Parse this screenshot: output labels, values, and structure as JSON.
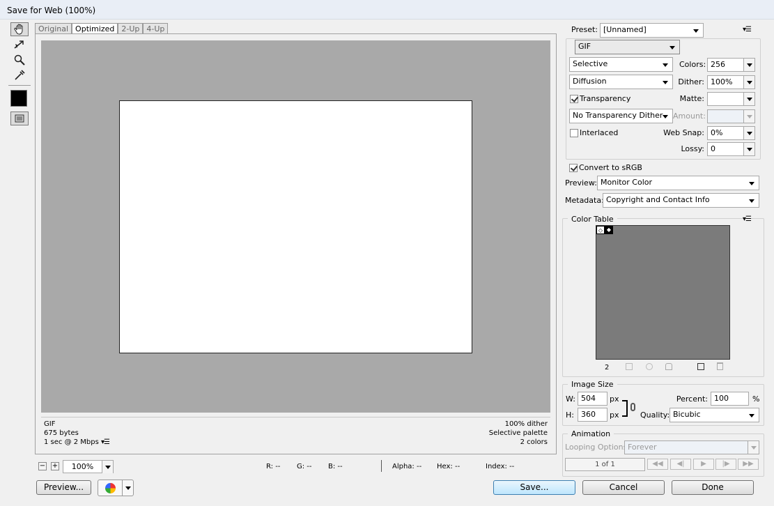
{
  "window": {
    "title": "Save for Web (100%)"
  },
  "toolbox": {
    "tools": [
      "hand-icon",
      "slice-select-icon",
      "zoom-icon",
      "eyedropper-icon"
    ],
    "eyedropper_color": "#000000"
  },
  "tabs": [
    "Original",
    "Optimized",
    "2-Up",
    "4-Up"
  ],
  "active_tab": "Optimized",
  "info": {
    "format": "GIF",
    "size": "675 bytes",
    "speed": "1 sec @ 2 Mbps",
    "dither": "100% dither",
    "palette": "Selective palette",
    "colors": "2 colors"
  },
  "statusbar": {
    "zoom": "100%",
    "r": "R: --",
    "g": "G: --",
    "b": "B: --",
    "alpha": "Alpha: --",
    "hex": "Hex: --",
    "index": "Index: --"
  },
  "settings": {
    "preset_label": "Preset:",
    "preset": "[Unnamed]",
    "format": "GIF",
    "reduction": "Selective",
    "dither_algo": "Diffusion",
    "colors_label": "Colors:",
    "colors": "256",
    "dither_label": "Dither:",
    "dither": "100%",
    "transparency_label": "Transparency",
    "transparency": true,
    "matte_label": "Matte:",
    "matte": "",
    "transparency_dither": "No Transparency Dither",
    "amount_label": "Amount:",
    "amount": "",
    "interlaced_label": "Interlaced",
    "interlaced": false,
    "websnap_label": "Web Snap:",
    "websnap": "0%",
    "lossy_label": "Lossy:",
    "lossy": "0",
    "convert_label": "Convert to sRGB",
    "convert": true,
    "preview_label": "Preview:",
    "preview": "Monitor Color",
    "metadata_label": "Metadata:",
    "metadata": "Copyright and Contact Info"
  },
  "color_table": {
    "title": "Color Table",
    "count": "2",
    "colors": [
      "#ffffff",
      "#000000"
    ]
  },
  "image_size": {
    "title": "Image Size",
    "w_label": "W:",
    "w": "504",
    "h_label": "H:",
    "h": "360",
    "px": "px",
    "percent_label": "Percent:",
    "percent": "100",
    "pct": "%",
    "quality_label": "Quality:",
    "quality": "Bicubic"
  },
  "animation": {
    "title": "Animation",
    "looping_label": "Looping Options:",
    "looping": "Forever",
    "frame": "1 of 1"
  },
  "buttons": {
    "preview": "Preview...",
    "save": "Save...",
    "cancel": "Cancel",
    "done": "Done"
  }
}
